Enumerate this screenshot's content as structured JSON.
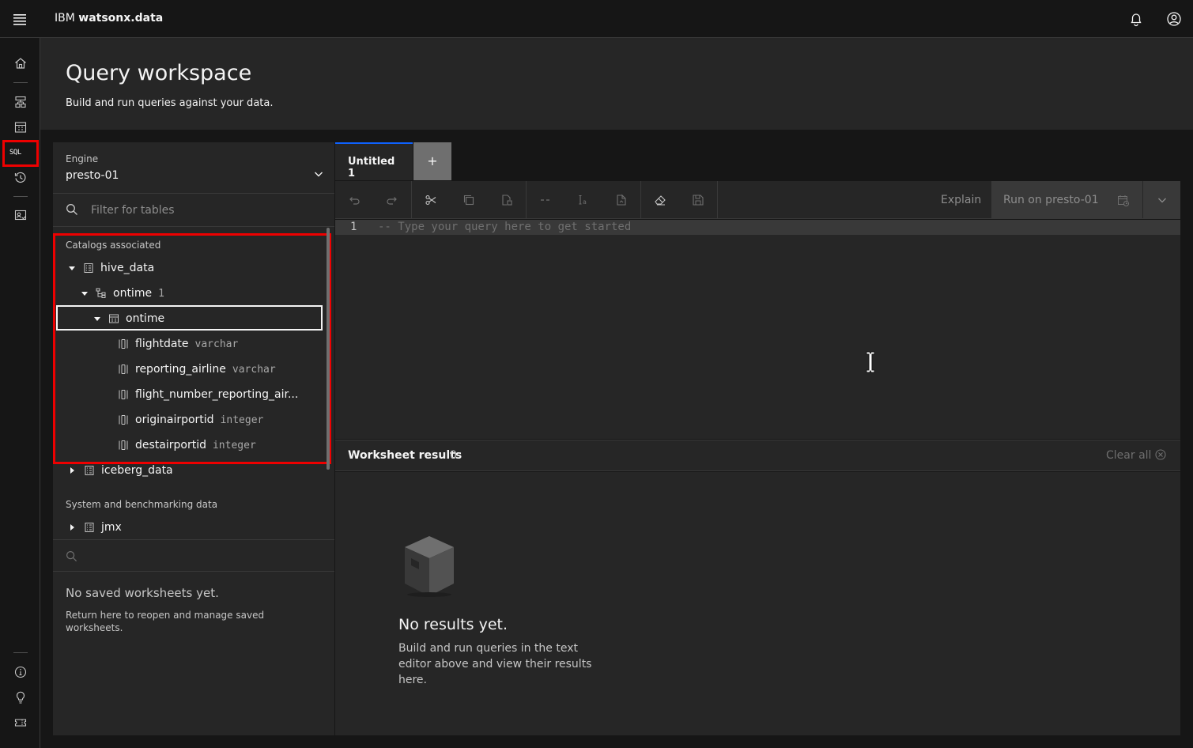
{
  "header": {
    "brand_prefix": "IBM",
    "brand_name": "watsonx.data",
    "icons": [
      "menu-icon",
      "notification-icon",
      "user-avatar-icon"
    ]
  },
  "rail": {
    "items": [
      "home-icon",
      "infrastructure-icon",
      "data-manager-icon",
      "sql-icon",
      "query-history-icon",
      "access-control-icon"
    ],
    "sql_label": "SQL",
    "bottom_items": [
      "info-icon",
      "lightbulb-icon",
      "ticket-icon"
    ]
  },
  "page": {
    "title": "Query workspace",
    "subtitle": "Build and run queries against your data."
  },
  "engine": {
    "label": "Engine",
    "value": "presto-01"
  },
  "filter": {
    "placeholder": "Filter for tables"
  },
  "catalogs": {
    "section_label": "Catalogs associated",
    "hive": "hive_data",
    "schema_name": "ontime",
    "schema_count": "1",
    "table_name": "ontime",
    "columns": [
      {
        "name": "flightdate",
        "type": "varchar"
      },
      {
        "name": "reporting_airline",
        "type": "varchar"
      },
      {
        "name": "flight_number_reporting_air...",
        "type": ""
      },
      {
        "name": "originairportid",
        "type": "integer"
      },
      {
        "name": "destairportid",
        "type": "integer"
      }
    ],
    "iceberg": "iceberg_data"
  },
  "system": {
    "section_label": "System and benchmarking data",
    "jmx": "jmx"
  },
  "worksheets": {
    "empty_title": "No saved worksheets yet.",
    "empty_desc": "Return here to reopen and manage saved worksheets."
  },
  "editor": {
    "tab_label": "Untitled 1",
    "add_tab": "+",
    "toolbar_icons": [
      "undo-icon",
      "redo-icon",
      "cut-icon",
      "copy-icon",
      "paste-icon",
      "comment-icon",
      "format-icon",
      "paste-special-icon",
      "erase-icon",
      "save-icon"
    ],
    "explain_label": "Explain",
    "run_label": "Run on presto-01",
    "line_number": "1",
    "placeholder": "-- Type your query here to get started"
  },
  "results": {
    "title": "Worksheet results",
    "count": "0",
    "clear_all": "Clear all",
    "empty_title": "No results yet.",
    "empty_desc": "Build and run queries in the text editor above and view their results here."
  }
}
